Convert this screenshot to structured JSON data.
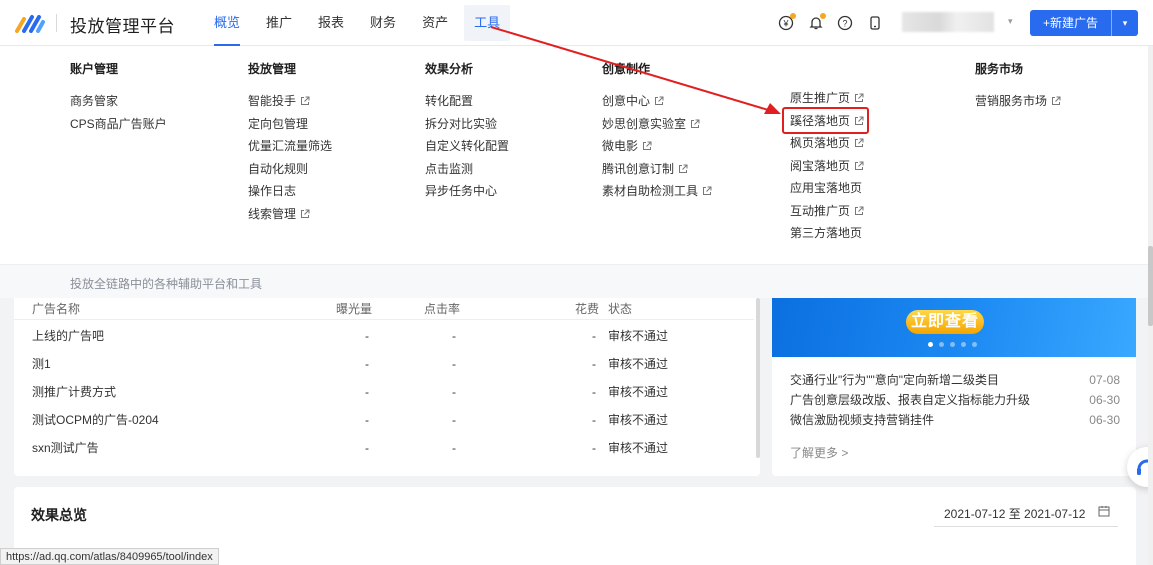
{
  "brand": "投放管理平台",
  "nav": [
    {
      "label": "概览",
      "state": "active"
    },
    {
      "label": "推广",
      "state": ""
    },
    {
      "label": "报表",
      "state": ""
    },
    {
      "label": "财务",
      "state": ""
    },
    {
      "label": "资产",
      "state": ""
    },
    {
      "label": "工具",
      "state": "hover"
    }
  ],
  "new_ad_label": "+新建广告",
  "colors": {
    "primary": "#296bef",
    "annotation": "#e02020"
  },
  "menu": {
    "account": {
      "title": "账户管理",
      "items": [
        "商务管家",
        "CPS商品广告账户"
      ]
    },
    "delivery": {
      "title": "投放管理",
      "items": [
        "智能投手",
        "定向包管理",
        "优量汇流量筛选",
        "自动化规则",
        "操作日志",
        "线索管理"
      ]
    },
    "analysis": {
      "title": "效果分析",
      "items": [
        "转化配置",
        "拆分对比实验",
        "自定义转化配置",
        "点击监测",
        "异步任务中心"
      ]
    },
    "creative": {
      "title": "创意制作",
      "items": [
        "创意中心",
        "妙思创意实验室",
        "微电影",
        "腾讯创意订制",
        "素材自助检测工具"
      ]
    },
    "landing": {
      "items": [
        "原生推广页",
        "蹊径落地页",
        "枫页落地页",
        "阅宝落地页",
        "应用宝落地页",
        "互动推广页",
        "第三方落地页"
      ]
    },
    "service": {
      "title": "服务市场",
      "items": [
        "营销服务市场"
      ]
    },
    "footer": "投放全链路中的各种辅助平台和工具"
  },
  "ad_table": {
    "headers": [
      "广告名称",
      "曝光量",
      "点击率",
      "花费",
      "状态"
    ],
    "rows": [
      [
        "上线的广告吧",
        "-",
        "-",
        "-",
        "审核不通过"
      ],
      [
        "测1",
        "-",
        "-",
        "-",
        "审核不通过"
      ],
      [
        "测推广计费方式",
        "-",
        "-",
        "-",
        "审核不通过"
      ],
      [
        "测试OCPM的广告-0204",
        "-",
        "-",
        "-",
        "审核不通过"
      ],
      [
        "sxn测试广告",
        "-",
        "-",
        "-",
        "审核不通过"
      ]
    ]
  },
  "banner": {
    "button": "立即查看"
  },
  "news": [
    {
      "title": "交通行业\"行为\"\"意向\"定向新增二级类目",
      "date": "07-08"
    },
    {
      "title": "广告创意层级改版、报表自定义指标能力升级",
      "date": "06-30"
    },
    {
      "title": "微信激励视频支持营销挂件",
      "date": "06-30"
    }
  ],
  "more_label": "了解更多 >",
  "overview": {
    "title": "效果总览",
    "date_range": "2021-07-12 至 2021-07-12"
  },
  "status_url": "https://ad.qq.com/atlas/8409965/tool/index"
}
